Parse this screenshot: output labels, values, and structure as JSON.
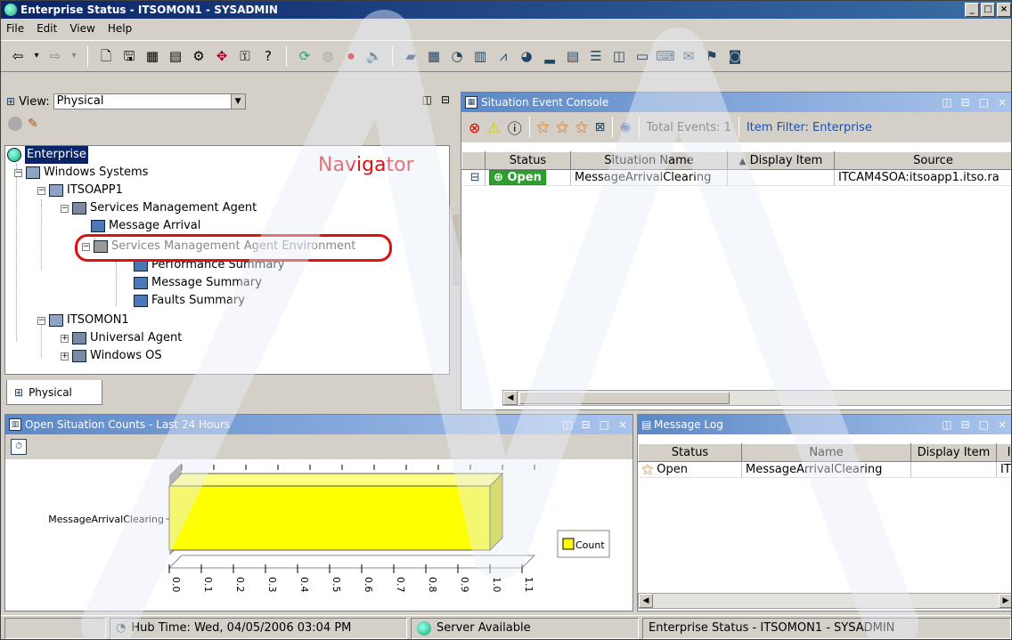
{
  "window": {
    "title": "Enterprise Status - ITSOMON1 - SYSADMIN",
    "min": "_",
    "max": "□",
    "close": "×"
  },
  "menu": [
    "File",
    "Edit",
    "View",
    "Help"
  ],
  "toolbar": {
    "icons": [
      "back-arrow-icon",
      "back-dropdown-icon",
      "forward-arrow-icon",
      "forward-dropdown-icon",
      "new-workspace-icon",
      "save-icon",
      "properties-icon",
      "situation-editor-icon",
      "workflow-editor-icon",
      "query-editor-icon",
      "manage-tivoli-icon",
      "history-icon",
      "refresh-icon",
      "pause-icon",
      "stop-icon",
      "speaker-icon",
      "chart-icon",
      "table-icon",
      "plot-icon",
      "bar-chart-icon",
      "graph-icon",
      "pie-chart-icon",
      "area-chart-icon",
      "notepad-icon",
      "event-console-icon",
      "browser-icon",
      "message-icon",
      "terminal-icon",
      "universal-message-icon",
      "take-action-icon",
      "topology-icon"
    ]
  },
  "navigator": {
    "view_label": "View:",
    "view_value": "Physical",
    "title_label": "Navigator",
    "tab_label": "Physical",
    "nodes": [
      {
        "label": "Enterprise"
      },
      {
        "label": "Windows Systems"
      },
      {
        "label": "ITSOAPP1"
      },
      {
        "label": "Services Management Agent"
      },
      {
        "label": "Message Arrival"
      },
      {
        "label": "Services Management Agent Environment"
      },
      {
        "label": "Performance Summary"
      },
      {
        "label": "Message Summary"
      },
      {
        "label": "Faults Summary"
      },
      {
        "label": "ITSOMON1"
      },
      {
        "label": "Universal Agent"
      },
      {
        "label": "Windows OS"
      }
    ]
  },
  "event_console": {
    "title": "Situation Event Console",
    "total_events": "Total Events: 1",
    "item_filter": "Item Filter: Enterprise",
    "columns": [
      "Status",
      "Situation Name",
      "Display Item",
      "Source"
    ],
    "rows": [
      {
        "status": "Open",
        "name": "MessageArrivalClearing",
        "display_item": "",
        "source": "ITCAM4SOA:itsoapp1.itso.ra"
      }
    ]
  },
  "chart_panel": {
    "title": "Open Situation Counts - Last 24 Hours"
  },
  "chart_data": {
    "type": "bar",
    "orientation": "horizontal",
    "title": "",
    "categories": [
      "MessageArrivalClearing"
    ],
    "series": [
      {
        "name": "Count",
        "values": [
          1
        ]
      }
    ],
    "xlim": [
      0,
      1.1
    ],
    "xticks": [
      "0.0",
      "0.1",
      "0.2",
      "0.3",
      "0.4",
      "0.5",
      "0.6",
      "0.7",
      "0.8",
      "0.9",
      "1.0",
      "1.1"
    ],
    "legend": "right",
    "bar_color": "#ffff00"
  },
  "message_log": {
    "title": "Message Log",
    "columns": [
      "Status",
      "Name",
      "Display Item",
      "I"
    ],
    "rows": [
      {
        "status": "Open",
        "name": "MessageArrivalClearing",
        "display_item": "",
        "extra": "IT"
      }
    ]
  },
  "statusbar": {
    "hub_time": "Hub Time: Wed, 04/05/2006 03:04 PM",
    "server": "Server Available",
    "context": "Enterprise Status - ITSOMON1 - SYSADMIN"
  },
  "colors": {
    "title_gradient_start": "#0a246a",
    "panel_header": "#5b88c8",
    "highlight_box": "#e01010",
    "bar": "#ffff00"
  }
}
